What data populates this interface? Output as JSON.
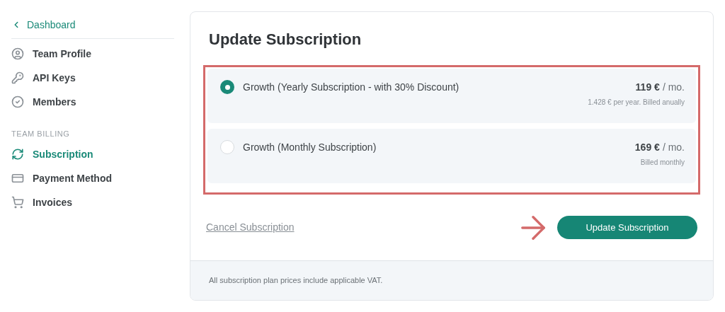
{
  "sidebar": {
    "back_link": "Dashboard",
    "items": [
      {
        "label": "Team Profile",
        "selected": false
      },
      {
        "label": "API Keys",
        "selected": false
      },
      {
        "label": "Members",
        "selected": false
      }
    ],
    "section_title": "TEAM BILLING",
    "billing_items": [
      {
        "label": "Subscription",
        "selected": true
      },
      {
        "label": "Payment Method",
        "selected": false
      },
      {
        "label": "Invoices",
        "selected": false
      }
    ]
  },
  "card": {
    "title": "Update Subscription",
    "plans": [
      {
        "name": "Growth (Yearly Subscription - with 30% Discount)",
        "price": "119 €",
        "unit": "/ mo.",
        "note": "1.428 € per year. Billed anually",
        "selected": true
      },
      {
        "name": "Growth (Monthly Subscription)",
        "price": "169 €",
        "unit": "/ mo.",
        "note": "Billed monthly",
        "selected": false
      }
    ],
    "cancel_link": "Cancel Subscription",
    "submit_button": "Update Subscription",
    "footer_note": "All subscription plan prices include applicable VAT."
  }
}
